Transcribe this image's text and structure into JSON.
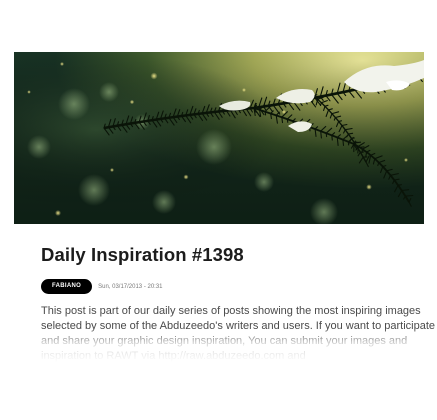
{
  "post": {
    "title": "Daily Inspiration #1398",
    "author": "FABIANO",
    "date": "Sun, 03/17/2013 - 20:31",
    "excerpt": "This post is part of our daily series of posts showing the most inspiring images selected by some of the Abduzeedo's writers and users. If you want to participate and share your graphic design inspiration, You can submit your images and inspiration to RAWT via http://raw.abduzeedo.com and"
  },
  "hero": {
    "subject": "snow-covered pine branch with bokeh",
    "colors": {
      "dark": "#0f1f17",
      "mid": "#3e5a2c",
      "glow": "#d9dc86",
      "needles": "#0a1408",
      "snow": "#f2f3ec"
    }
  }
}
